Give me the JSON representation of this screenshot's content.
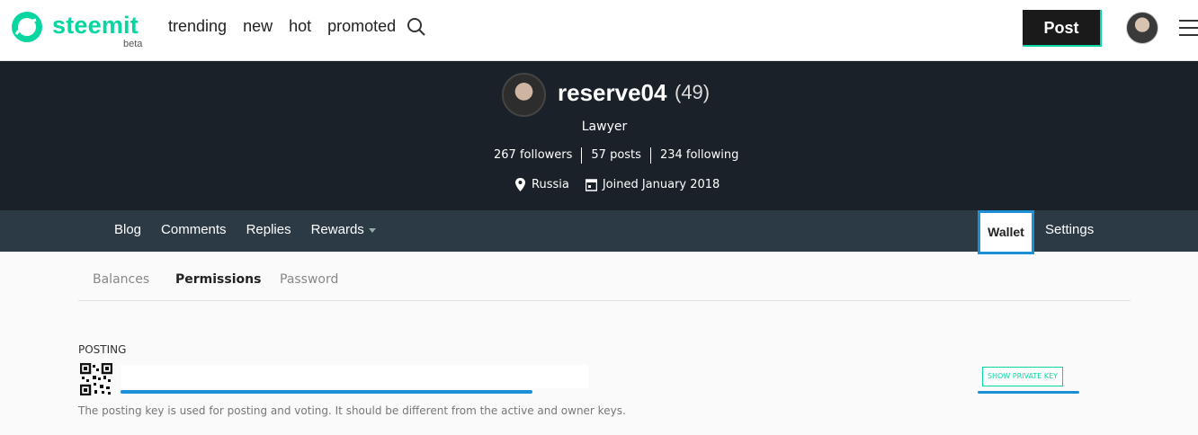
{
  "header": {
    "brand": "steemit",
    "beta": "beta",
    "nav": [
      "trending",
      "new",
      "hot",
      "promoted"
    ],
    "post_label": "Post"
  },
  "profile": {
    "username": "reserve04",
    "reputation": "(49)",
    "about": "Lawyer",
    "followers": "267 followers",
    "posts": "57 posts",
    "following": "234 following",
    "location": "Russia",
    "joined": "Joined January 2018"
  },
  "profile_nav": {
    "items": [
      "Blog",
      "Comments",
      "Replies",
      "Rewards"
    ],
    "wallet": "Wallet",
    "settings": "Settings"
  },
  "wallet_tabs": {
    "balances": "Balances",
    "permissions": "Permissions",
    "password": "Password"
  },
  "posting": {
    "label": "POSTING",
    "show_key": "SHOW PRIVATE KEY",
    "description": "The posting key is used for posting and voting. It should be different from the active and owner keys."
  },
  "colors": {
    "brand": "#07d6a0",
    "hero_bg": "#1a2129",
    "nav_bg": "#2c3a45",
    "highlight": "#1b90d6"
  }
}
